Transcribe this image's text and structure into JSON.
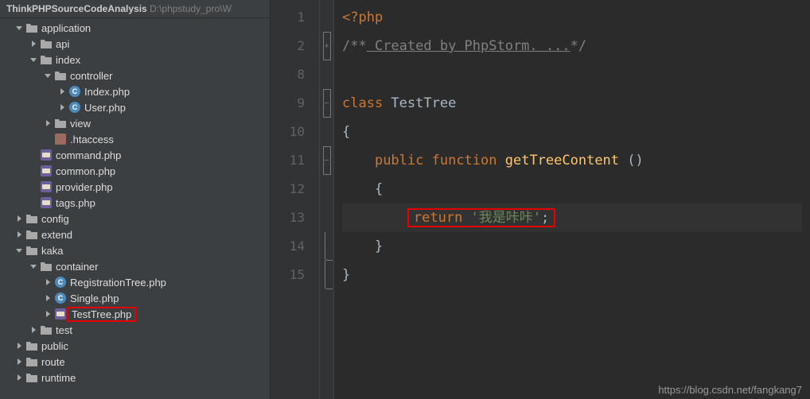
{
  "breadcrumb": {
    "project": "ThinkPHPSourceCodeAnalysis",
    "path": "D:\\phpstudy_pro\\W"
  },
  "tree": [
    {
      "depth": 0,
      "arrow": "down",
      "icon": "folder",
      "label": "application",
      "name": "folder-application"
    },
    {
      "depth": 1,
      "arrow": "right",
      "icon": "folder",
      "label": "api",
      "name": "folder-api"
    },
    {
      "depth": 1,
      "arrow": "down",
      "icon": "folder",
      "label": "index",
      "name": "folder-index"
    },
    {
      "depth": 2,
      "arrow": "down",
      "icon": "folder",
      "label": "controller",
      "name": "folder-controller"
    },
    {
      "depth": 3,
      "arrow": "right",
      "icon": "class",
      "label": "Index.php",
      "name": "file-index-php"
    },
    {
      "depth": 3,
      "arrow": "right",
      "icon": "class",
      "label": "User.php",
      "name": "file-user-php"
    },
    {
      "depth": 2,
      "arrow": "right",
      "icon": "folder",
      "label": "view",
      "name": "folder-view"
    },
    {
      "depth": 2,
      "arrow": "",
      "icon": "htaccess",
      "label": ".htaccess",
      "name": "file-htaccess"
    },
    {
      "depth": 1,
      "arrow": "",
      "icon": "php",
      "label": "command.php",
      "name": "file-command-php"
    },
    {
      "depth": 1,
      "arrow": "",
      "icon": "php",
      "label": "common.php",
      "name": "file-common-php"
    },
    {
      "depth": 1,
      "arrow": "",
      "icon": "php",
      "label": "provider.php",
      "name": "file-provider-php"
    },
    {
      "depth": 1,
      "arrow": "",
      "icon": "php",
      "label": "tags.php",
      "name": "file-tags-php"
    },
    {
      "depth": 0,
      "arrow": "right",
      "icon": "folder",
      "label": "config",
      "name": "folder-config"
    },
    {
      "depth": 0,
      "arrow": "right",
      "icon": "folder",
      "label": "extend",
      "name": "folder-extend"
    },
    {
      "depth": 0,
      "arrow": "down",
      "icon": "folder",
      "label": "kaka",
      "name": "folder-kaka"
    },
    {
      "depth": 1,
      "arrow": "down",
      "icon": "folder",
      "label": "container",
      "name": "folder-container"
    },
    {
      "depth": 2,
      "arrow": "right",
      "icon": "class",
      "label": "RegistrationTree.php",
      "name": "file-registrationtree-php"
    },
    {
      "depth": 2,
      "arrow": "right",
      "icon": "class",
      "label": "Single.php",
      "name": "file-single-php"
    },
    {
      "depth": 2,
      "arrow": "right",
      "icon": "php",
      "label": "TestTree.php",
      "name": "file-testtree-php",
      "hl": true
    },
    {
      "depth": 1,
      "arrow": "right",
      "icon": "folder",
      "label": "test",
      "name": "folder-test"
    },
    {
      "depth": 0,
      "arrow": "right",
      "icon": "folder",
      "label": "public",
      "name": "folder-public"
    },
    {
      "depth": 0,
      "arrow": "right",
      "icon": "folder",
      "label": "route",
      "name": "folder-route"
    },
    {
      "depth": 0,
      "arrow": "right",
      "icon": "folder",
      "label": "runtime",
      "name": "folder-runtime"
    }
  ],
  "editor": {
    "lines": [
      "1",
      "2",
      "8",
      "9",
      "10",
      "11",
      "12",
      "13",
      "14",
      "15"
    ],
    "fold": [
      "",
      "plus",
      "",
      "mid",
      "",
      "mid",
      "",
      "",
      "edge",
      "edge"
    ],
    "tokens": {
      "l1": "<?php",
      "l2a": "/**",
      "l2b": " Created by PhpStorm. ...",
      "l2c": "*/",
      "l9a": "class",
      "l9b": " TestTree",
      "l10": "{",
      "l11a": "public",
      "l11b": " function",
      "l11c": " getTreeContent",
      "l11d": " ()",
      "l12": "{",
      "l13a": "return",
      "l13b": " '我是咔咔'",
      "l13c": ";",
      "l14": "}",
      "l15": "}"
    }
  },
  "watermark": "https://blog.csdn.net/fangkang7"
}
